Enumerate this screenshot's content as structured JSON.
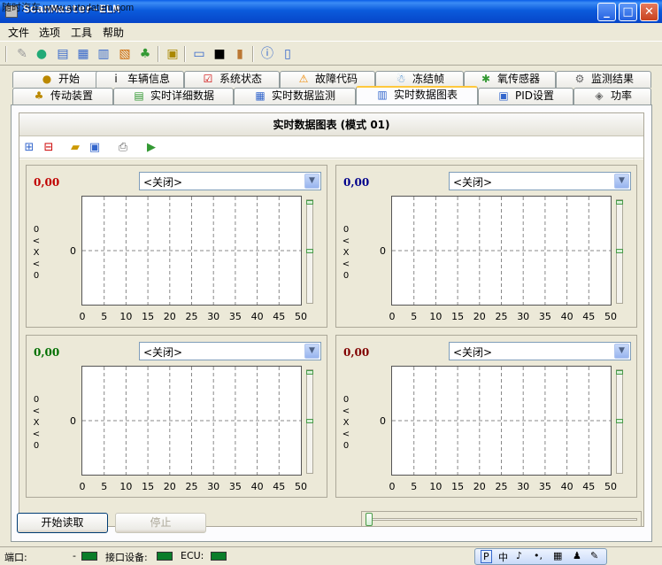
{
  "window": {
    "title": "ScanMaster-ELM",
    "watermark": "随时汽车 www.autodatum.com",
    "min": "_",
    "max": "□",
    "close": "✕"
  },
  "menu": [
    "文件",
    "选项",
    "工具",
    "帮助"
  ],
  "tabs_row1": [
    {
      "label": "开始",
      "icon": "●"
    },
    {
      "label": "车辆信息",
      "icon": "i"
    },
    {
      "label": "系统状态",
      "icon": "☑"
    },
    {
      "label": "故障代码",
      "icon": "⚠"
    },
    {
      "label": "冻结帧",
      "icon": "☃"
    },
    {
      "label": "氧传感器",
      "icon": "✱"
    },
    {
      "label": "监测结果",
      "icon": "⚙"
    }
  ],
  "tabs_row2": [
    {
      "label": "传动装置",
      "icon": "♣"
    },
    {
      "label": "实时详细数据",
      "icon": "▤"
    },
    {
      "label": "实时数据监测",
      "icon": "▦"
    },
    {
      "label": "实时数据图表",
      "icon": "▥"
    },
    {
      "label": "PID设置",
      "icon": "▣"
    },
    {
      "label": "功率",
      "icon": "◈"
    }
  ],
  "panel": {
    "title": "实时数据图表 (模式 01)"
  },
  "charts": [
    {
      "value": "0,00",
      "color": "#c00000",
      "select": "<关闭>",
      "vlabel": [
        "0",
        "<",
        "X",
        "<",
        "0"
      ],
      "ytick": "0"
    },
    {
      "value": "0,00",
      "color": "#00008b",
      "select": "<关闭>",
      "vlabel": [
        "0",
        "<",
        "X",
        "<",
        "0"
      ],
      "ytick": "0"
    },
    {
      "value": "0,00",
      "color": "#007000",
      "select": "<关闭>",
      "vlabel": [
        "0",
        "<",
        "X",
        "<",
        "0"
      ],
      "ytick": "0"
    },
    {
      "value": "0,00",
      "color": "#800000",
      "select": "<关闭>",
      "vlabel": [
        "0",
        "<",
        "X",
        "<",
        "0"
      ],
      "ytick": "0"
    }
  ],
  "xticks": [
    "0",
    "5",
    "10",
    "15",
    "20",
    "25",
    "30",
    "35",
    "40",
    "45",
    "50"
  ],
  "buttons": {
    "start": "开始读取",
    "stop": "停止"
  },
  "status": {
    "port_label": "端口:",
    "port_value": "-",
    "iface_label": "接口设备:",
    "ecu_label": "ECU:"
  },
  "ime": [
    "P",
    "中",
    "♪",
    "•,",
    "▦",
    "♟",
    "✎"
  ]
}
